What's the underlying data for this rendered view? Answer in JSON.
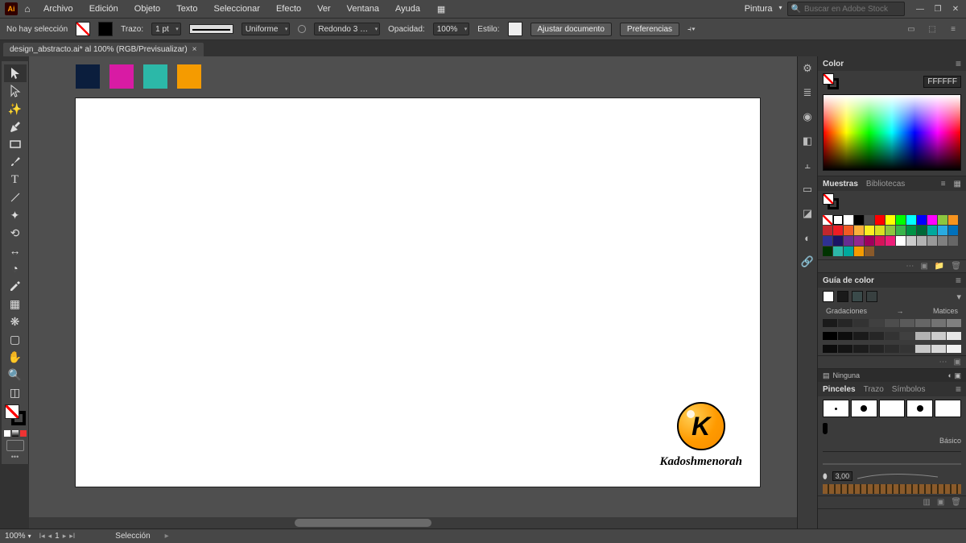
{
  "app": {
    "logo": "Ai"
  },
  "menu": [
    "Archivo",
    "Edición",
    "Objeto",
    "Texto",
    "Seleccionar",
    "Efecto",
    "Ver",
    "Ventana",
    "Ayuda"
  ],
  "workspace": "Pintura",
  "search_placeholder": "Buscar en Adobe Stock",
  "optbar": {
    "selection": "No hay selección",
    "stroke_label": "Trazo:",
    "stroke_val": "1 pt",
    "uniform": "Uniforme",
    "round": "Redondo 3 …",
    "opacity_label": "Opacidad:",
    "opacity_val": "100%",
    "style_label": "Estilo:",
    "fit": "Ajustar documento",
    "prefs": "Preferencias"
  },
  "doc_tab": "design_abstracto.ai* al 100% (RGB/Previsualizar)",
  "palette": [
    "#0b1e3d",
    "#d81ba4",
    "#2cb8a8",
    "#f59b00"
  ],
  "logo_text": "Kadoshmenorah",
  "logo_letter": "K",
  "status": {
    "zoom": "100%",
    "page": "1",
    "tool": "Selección"
  },
  "panels": {
    "color": {
      "title": "Color",
      "hex": "FFFFFF"
    },
    "swatches": {
      "tabs": [
        "Muestras",
        "Bibliotecas"
      ]
    },
    "guide": {
      "title": "Guía de color",
      "grad": "Gradaciones",
      "matiz": "Matices"
    },
    "none_label": "Ninguna",
    "brushes": {
      "tabs": [
        "Pinceles",
        "Trazo",
        "Símbolos"
      ],
      "basic": "Básico",
      "size": "3,00"
    }
  },
  "swatches_colors": [
    "none",
    "reg",
    "#ffffff",
    "#000000",
    "#4d4d4d",
    "#ff0000",
    "#ffff00",
    "#00ff00",
    "#00ffff",
    "#0000ff",
    "#ff00ff",
    "#8cc63f",
    "#f7931e",
    "#c1272d",
    "#ed1c24",
    "#f15a24",
    "#fbb03b",
    "#fcee21",
    "#d9e021",
    "#8cc63f",
    "#39b54a",
    "#009245",
    "#006837",
    "#00a99d",
    "#29abe2",
    "#0071bc",
    "#2e3192",
    "#1b1464",
    "#662d91",
    "#93278f",
    "#9e005d",
    "#d4145a",
    "#ed1e79",
    "#ffffff",
    "#cccccc",
    "#b3b3b3",
    "#999999",
    "#808080",
    "#666666",
    "#003300",
    "#2cb8a8",
    "#00a99d",
    "#f59b00",
    "#8a5a2a"
  ],
  "grad_light": [
    "#1a1a1a",
    "#262626",
    "#333333",
    "#404040",
    "#4d4d4d",
    "#5a5a5a",
    "#666666",
    "#737373",
    "#808080"
  ],
  "grad_row2": [
    "#000000",
    "#0d0d0d",
    "#1a1a1a",
    "#262626",
    "#333333",
    "#404040",
    "#b3b3b3",
    "#cccccc",
    "#e6e6e6"
  ],
  "grad_row3": [
    "#0c0c0c",
    "#141414",
    "#1c1c1c",
    "#242424",
    "#2c2c2c",
    "#343434",
    "#c8c8c8",
    "#d8d8d8",
    "#f2f2f2"
  ]
}
